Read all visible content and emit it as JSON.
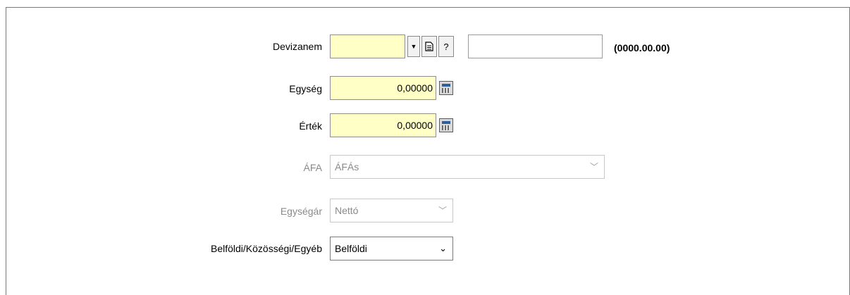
{
  "form": {
    "devizanem": {
      "label": "Devizanem",
      "value": "",
      "date_value": "",
      "date_format": "(0000.00.00)",
      "dropdown_icon": "caret-down-icon",
      "doc_icon": "document-icon",
      "help_label": "?"
    },
    "egyseg": {
      "label": "Egység",
      "value": "0,00000",
      "icon": "calculator-icon"
    },
    "ertek": {
      "label": "Érték",
      "value": "0,00000",
      "icon": "calculator-icon"
    },
    "afa": {
      "label": "ÁFA",
      "selected": "ÁFÁs",
      "disabled": true
    },
    "egysegar": {
      "label": "Egységár",
      "selected": "Nettó",
      "disabled": true
    },
    "belfoldi": {
      "label": "Belföldi/Közösségi/Egyéb",
      "selected": "Belföldi",
      "disabled": false
    }
  }
}
